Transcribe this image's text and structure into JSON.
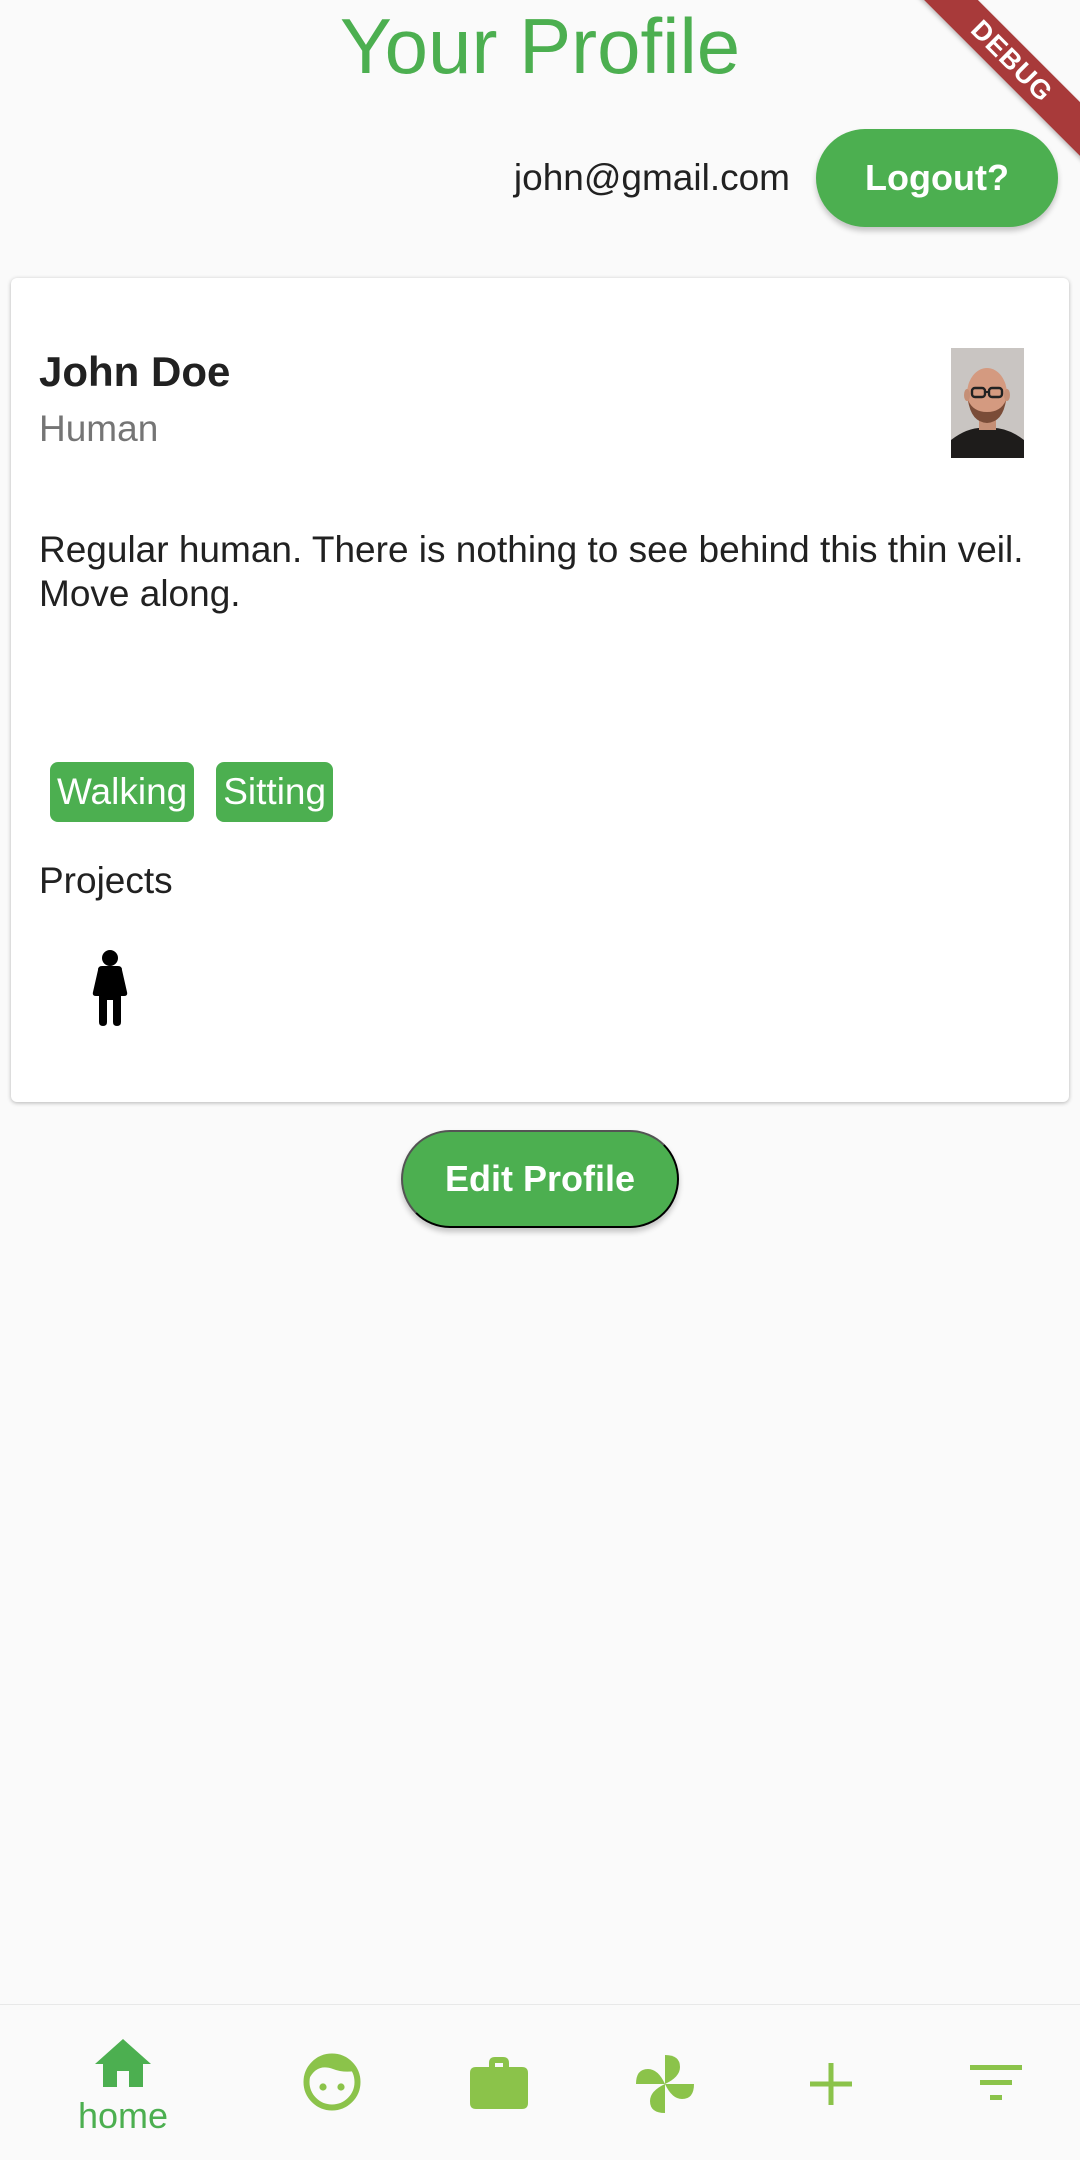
{
  "header": {
    "title": "Your Profile",
    "debug_banner": "DEBUG"
  },
  "account": {
    "email": "john@gmail.com",
    "logout_label": "Logout?"
  },
  "profile": {
    "name": "John Doe",
    "kind": "Human",
    "bio": "Regular human. There is nothing to see behind this thin veil. Move along.",
    "tags": [
      "Walking",
      "Sitting"
    ],
    "projects_heading": "Projects",
    "project_icons": [
      "person-icon"
    ]
  },
  "actions": {
    "edit_profile_label": "Edit Profile"
  },
  "bottom_nav": {
    "items": [
      {
        "icon": "home-icon",
        "label": "home",
        "active": true
      },
      {
        "icon": "face-icon",
        "label": ""
      },
      {
        "icon": "briefcase-icon",
        "label": ""
      },
      {
        "icon": "pinwheel-icon",
        "label": ""
      },
      {
        "icon": "add-icon",
        "label": ""
      },
      {
        "icon": "filter-icon",
        "label": ""
      }
    ]
  },
  "colors": {
    "primary": "#4caf50",
    "nav_inactive": "#8bc34a",
    "debug_banner": "#a83a3a",
    "background": "#fafafa"
  }
}
